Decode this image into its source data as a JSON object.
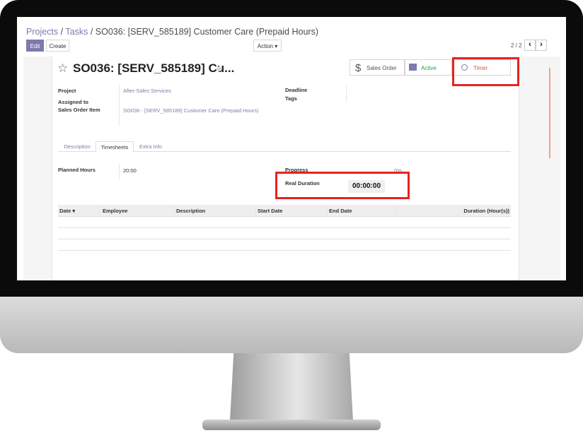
{
  "breadcrumb": {
    "projects": "Projects",
    "sep1": "/",
    "tasks": "Tasks",
    "sep2": "/",
    "current": "SO036: [SERV_585189] Customer Care (Prepaid Hours)"
  },
  "toolbar": {
    "edit_label": "Edit",
    "create_label": "Create",
    "action_label": "Action ▾"
  },
  "pager": {
    "text": "2 / 2",
    "prev": "‹",
    "next": "›"
  },
  "record": {
    "star": "☆",
    "title": "SO036: [SERV_585189] Cu...",
    "smart_buttons": {
      "sales_order": "Sales Order",
      "active": "Active",
      "timer": "Timer"
    },
    "fields": {
      "project_label": "Project",
      "project_value": "After-Sales Services",
      "assigned_label": "Assigned to",
      "sale_item_label": "Sales Order Item",
      "sale_item_value": "SO036 - [SERV_585189] Customer Care (Prepaid Hours)",
      "deadline_label": "Deadline",
      "tags_label": "Tags"
    }
  },
  "tabs": [
    {
      "label": "Description"
    },
    {
      "label": "Timesheets"
    },
    {
      "label": "Extra Info"
    }
  ],
  "timesheets": {
    "planned_label": "Planned Hours",
    "planned_value": "20:00",
    "progress_label": "Progress",
    "progress_value": "0%",
    "real_duration_label": "Real Duration",
    "real_duration_value": "00:00:00",
    "columns": [
      "Date ▾",
      "Employee",
      "Description",
      "Start Date",
      "End Date",
      "Duration (Hour(s))"
    ]
  },
  "colors": {
    "accent": "#7c7bad",
    "highlight": "#e5231f",
    "active_green": "#2e9e3f",
    "timer_red": "#d9534f"
  }
}
